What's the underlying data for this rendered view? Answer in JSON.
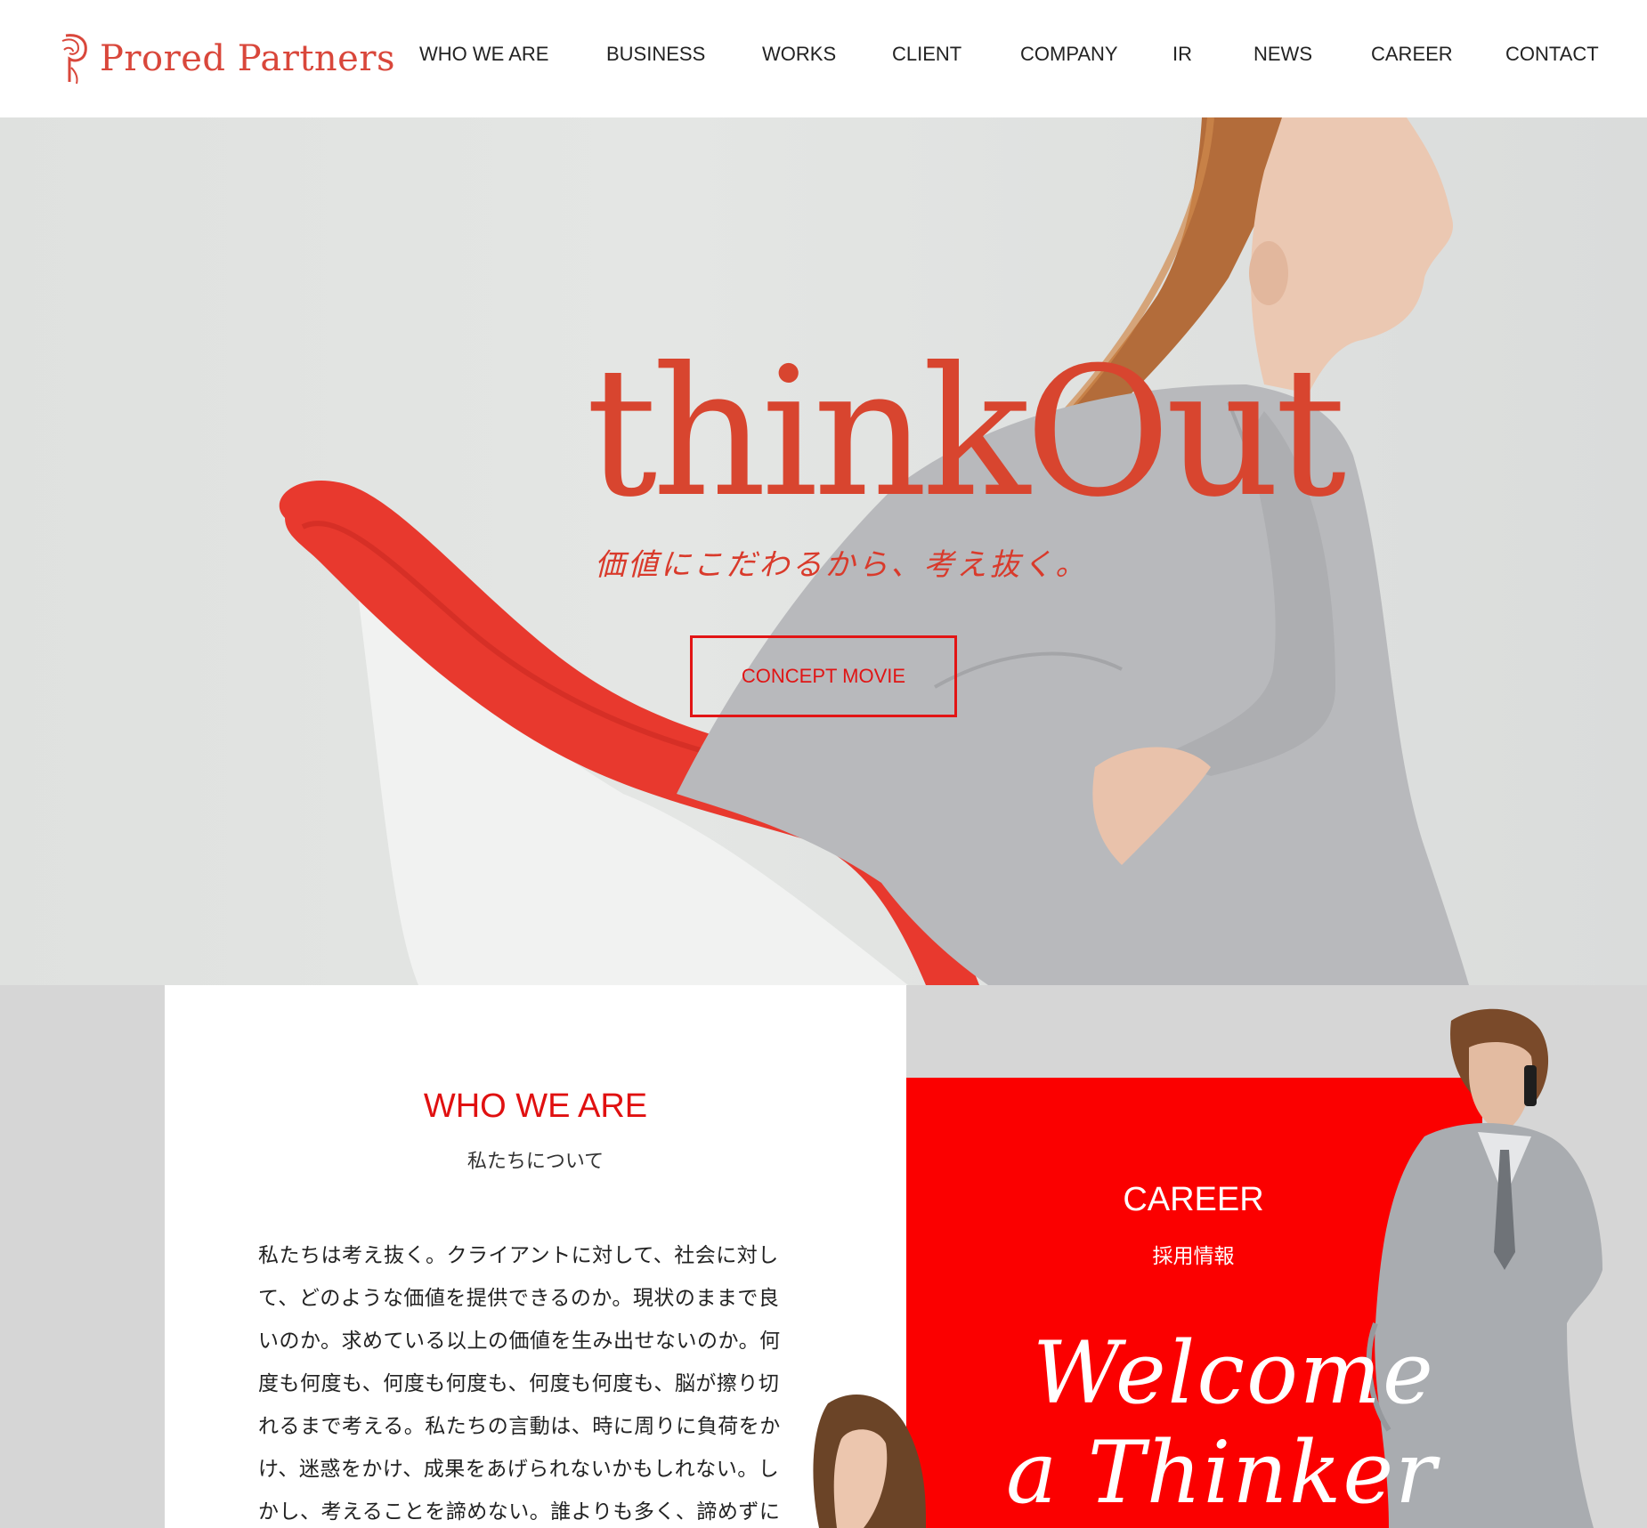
{
  "brand": {
    "name": "Prored Partners",
    "color": "#d9473b"
  },
  "nav": {
    "items": [
      {
        "label": "WHO WE ARE"
      },
      {
        "label": "BUSINESS"
      },
      {
        "label": "WORKS"
      },
      {
        "label": "CLIENT"
      },
      {
        "label": "COMPANY"
      },
      {
        "label": "IR"
      },
      {
        "label": "NEWS"
      },
      {
        "label": "CAREER"
      },
      {
        "label": "CONTACT"
      }
    ]
  },
  "hero": {
    "title": "thinkOut",
    "subtitle": "価値にこだわるから、考え抜く。",
    "button_label": "CONCEPT MOVIE",
    "accent": "#e01515"
  },
  "who": {
    "title": "WHO WE ARE",
    "subtitle": "私たちについて",
    "body": "私たちは考え抜く。クライアントに対して、社会に対して、どのような価値を提供できるのか。現状のままで良いのか。求めている以上の価値を生み出せないのか。何度も何度も、何度も何度も、何度も何度も、脳が擦り切れるまで考える。私たちの言動は、時に周りに負荷をかけ、迷惑をかけ、成果をあげられないかもしれない。しかし、考えることを諦めない。誰よりも多く、諦めずに"
  },
  "career": {
    "title": "CAREER",
    "subtitle": "採用情報",
    "tagline_line1": "Welcome",
    "tagline_line2": "a Thinker",
    "bg_color": "#fb0000"
  }
}
